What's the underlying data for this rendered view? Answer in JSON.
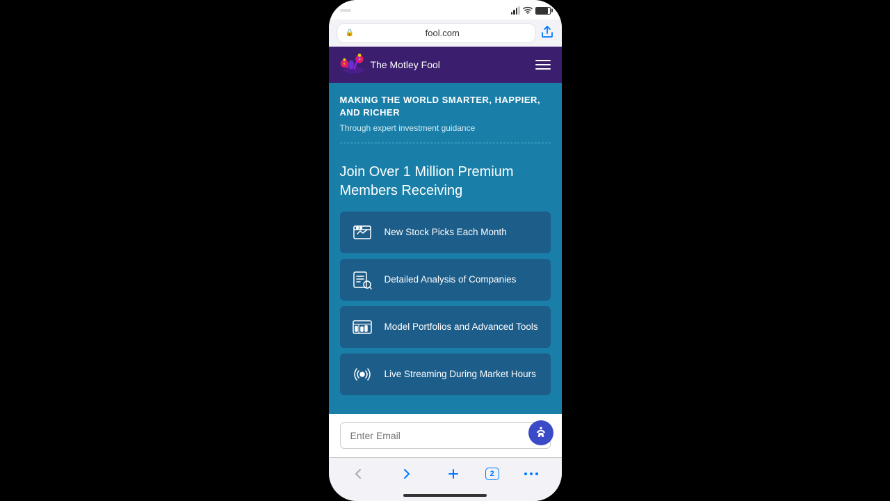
{
  "phone": {
    "statusBar": {
      "time": "",
      "url": "fool.com"
    },
    "nav": {
      "logoText": "The Motley Fool ™",
      "logoLine1": "The Motley Fool",
      "logoLine2": "™",
      "menuAriaLabel": "Menu"
    },
    "hero": {
      "headline": "MAKING THE WORLD SMARTER, HAPPIER, AND RICHER",
      "subtext": "Through expert investment guidance"
    },
    "joinSection": {
      "title": "Join Over 1 Million Premium Members Receiving"
    },
    "features": [
      {
        "id": "stock-picks",
        "label": "New Stock Picks Each Month",
        "icon": "stock-picks-icon"
      },
      {
        "id": "analysis",
        "label": "Detailed Analysis of Companies",
        "icon": "analysis-icon"
      },
      {
        "id": "model-portfolios",
        "label": "Model Portfolios and Advanced Tools",
        "icon": "portfolio-icon"
      },
      {
        "id": "live-streaming",
        "label": "Live Streaming During Market Hours",
        "icon": "streaming-icon"
      }
    ],
    "emailInput": {
      "placeholder": "Enter Email"
    },
    "browserBar": {
      "tabCount": "2"
    }
  }
}
